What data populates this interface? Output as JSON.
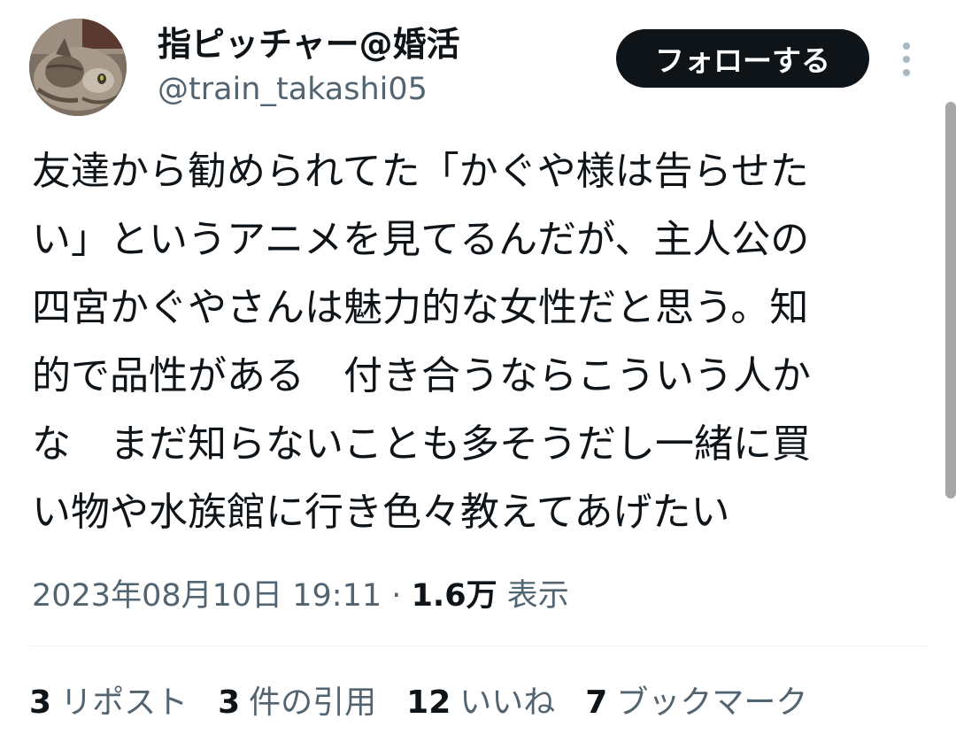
{
  "author": {
    "display_name": "指ピッチャー@婚活",
    "handle": "@train_takashi05",
    "avatar_icon": "cat-avatar-icon"
  },
  "follow_button_label": "フォローする",
  "more_icon": "more-vertical-icon",
  "tweet": {
    "lines": [
      "友達から勧められてた「かぐや様は告らせた",
      "い」というアニメを見てるんだが、主人公の",
      "四宮かぐやさんは魅力的な女性だと思う。知",
      "的で品性がある　付き合うならこういう人か",
      "な　まだ知らないことも多そうだし一緒に買",
      "い物や水族館に行き色々教えてあげたい"
    ]
  },
  "meta": {
    "timestamp": "2023年08月10日 19:11",
    "separator": "·",
    "views_count": "1.6万",
    "views_label": "表示"
  },
  "stats": [
    {
      "count": "3",
      "label": "リポスト"
    },
    {
      "count": "3",
      "label": "件の引用"
    },
    {
      "count": "12",
      "label": "いいね"
    },
    {
      "count": "7",
      "label": "ブックマーク"
    }
  ],
  "colors": {
    "text_primary": "#0f1419",
    "text_secondary": "#536471",
    "follow_button_bg": "#0f1419",
    "divider": "#eff3f4"
  }
}
